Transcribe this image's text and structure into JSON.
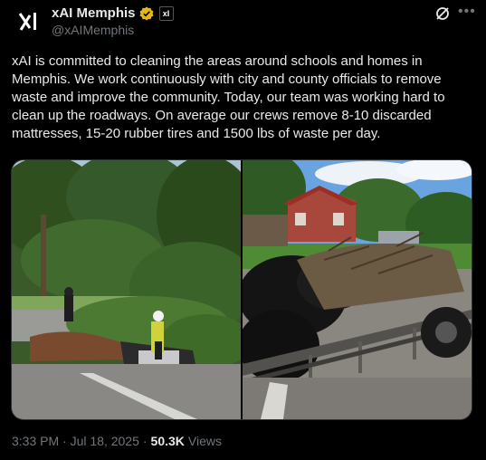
{
  "post": {
    "display_name": "xAI Memphis",
    "handle": "@xAIMemphis",
    "badge_text": "xI",
    "text": "xAI is committed to cleaning the areas around schools and homes in\nMemphis. We work continuously with city and county officials to remove\nwaste and improve the community. Today, our team was working hard to\nclean up the roadways. On average our crews remove 8-10 discarded\nmattresses, 15-20 rubber tires and 1500 lbs of waste per day.",
    "timestamp": "3:33 PM · Jul 18, 2025",
    "separator": "·",
    "views_count": "50.3K",
    "views_label": "Views"
  },
  "icons": {
    "avatar": "xai-logo-icon",
    "verified": "verified-badge-icon",
    "grok": "grok-icon",
    "more": "more-icon"
  },
  "colors": {
    "background": "#000000",
    "text": "#e7e9ea",
    "muted": "#71767b",
    "verified": "#e2b719"
  },
  "media": [
    {
      "name": "roadside-cleanup-photo"
    },
    {
      "name": "debris-trailer-photo"
    }
  ]
}
